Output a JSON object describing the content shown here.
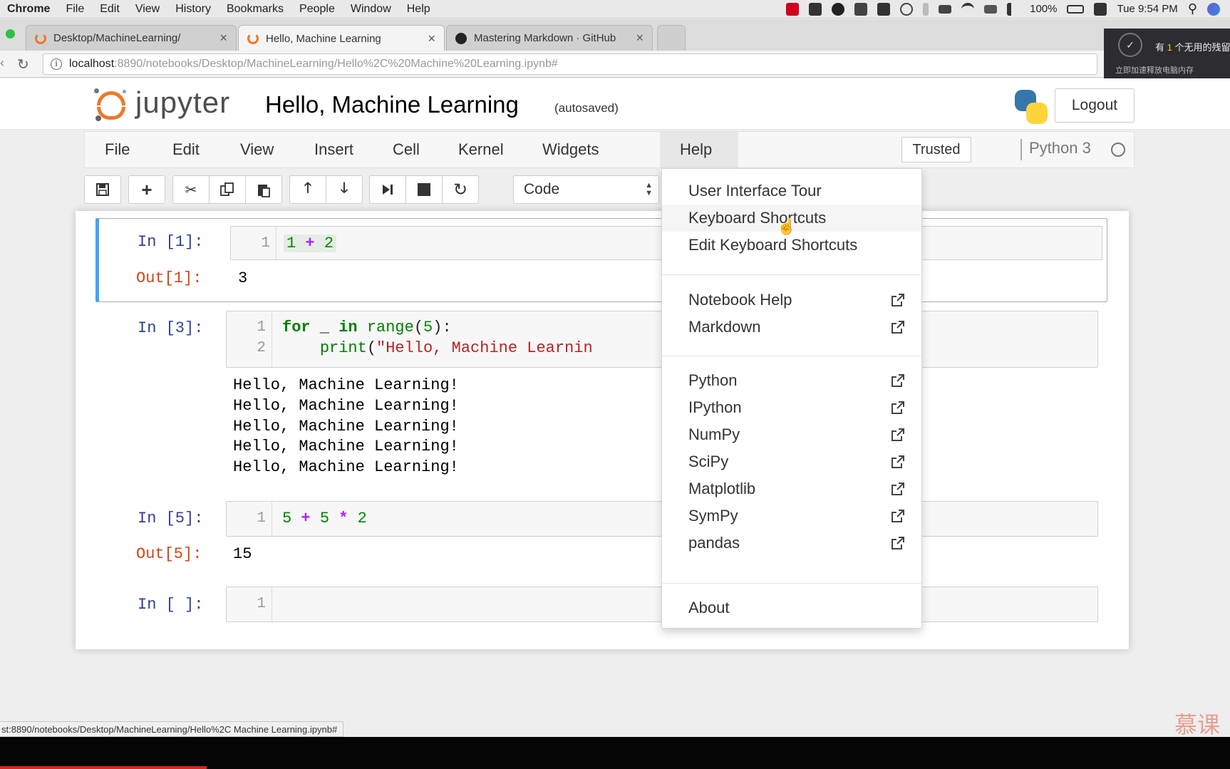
{
  "macbar": {
    "app": "Chrome",
    "menus": [
      "File",
      "Edit",
      "View",
      "History",
      "Bookmarks",
      "People",
      "Window",
      "Help"
    ],
    "battery": "100%",
    "clock": "Tue 9:54 PM"
  },
  "tabs": [
    {
      "label": "Desktop/MachineLearning/",
      "close": "×"
    },
    {
      "label": "Hello, Machine Learning",
      "close": "×"
    },
    {
      "label": "Mastering Markdown · GitHub",
      "close": "×"
    }
  ],
  "address": {
    "host": "localhost",
    "path": ":8890/notebooks/Desktop/MachineLearning/Hello%2C%20Machine%20Learning.ipynb#"
  },
  "overlay": {
    "line1_pre": "有 ",
    "line1_num": "1",
    "line1_post": " 个无用的残留",
    "line2": "立即加速释放电脑内存"
  },
  "jupyter": {
    "brand": "jupyter",
    "title": "Hello, Machine Learning",
    "autosave": "(autosaved)",
    "logout": "Logout",
    "menus": [
      "File",
      "Edit",
      "View",
      "Insert",
      "Cell",
      "Kernel",
      "Widgets",
      "Help"
    ],
    "trusted": "Trusted",
    "kernel": "Python 3",
    "cell_type": "Code"
  },
  "toolbar_icons": [
    "save-icon",
    "plus-icon",
    "scissors-icon",
    "copy-icon",
    "paste-icon",
    "arrow-up-icon",
    "arrow-down-icon",
    "run-icon",
    "stop-icon",
    "restart-icon"
  ],
  "cells": [
    {
      "in_prompt": "In [1]:",
      "line_numbers": [
        "1"
      ],
      "out_prompt": "Out[1]:",
      "output": "3"
    },
    {
      "in_prompt": "In [3]:",
      "line_numbers": [
        "1",
        "2"
      ],
      "stdout": [
        "Hello, Machine Learning!",
        "Hello, Machine Learning!",
        "Hello, Machine Learning!",
        "Hello, Machine Learning!",
        "Hello, Machine Learning!"
      ]
    },
    {
      "in_prompt": "In [5]:",
      "line_numbers": [
        "1"
      ],
      "out_prompt": "Out[5]:",
      "output": "15"
    },
    {
      "in_prompt": "In [ ]:",
      "line_numbers": [
        "1"
      ]
    }
  ],
  "code": {
    "c1": {
      "a": "1",
      "op": "+",
      "b": "2"
    },
    "c2": {
      "kw_for": "for",
      "var": " _ ",
      "kw_in": "in",
      "fn": " range",
      "lp": "(",
      "n": "5",
      "rp": "):",
      "indent": "    ",
      "print": "print",
      "lp2": "(",
      "str": "\"Hello, Machine Learnin"
    },
    "c3": {
      "a": "5",
      "op1": "+",
      "b": "5",
      "op2": "*",
      "c": "2"
    }
  },
  "help_menu": {
    "group1": [
      "User Interface Tour",
      "Keyboard Shortcuts",
      "Edit Keyboard Shortcuts"
    ],
    "group2": [
      "Notebook Help",
      "Markdown"
    ],
    "group3": [
      "Python",
      "IPython",
      "NumPy",
      "SciPy",
      "Matplotlib",
      "SymPy",
      "pandas"
    ],
    "group4": [
      "About"
    ]
  },
  "status_url": "st:8890/notebooks/Desktop/MachineLearning/Hello%2C Machine Learning.ipynb#",
  "watermark": "慕课",
  "colors": {
    "jupyter_orange": "#f37626",
    "in_prompt": "#303f9f",
    "out_prompt": "#d84315",
    "selected_cell": "#42a5f5"
  }
}
